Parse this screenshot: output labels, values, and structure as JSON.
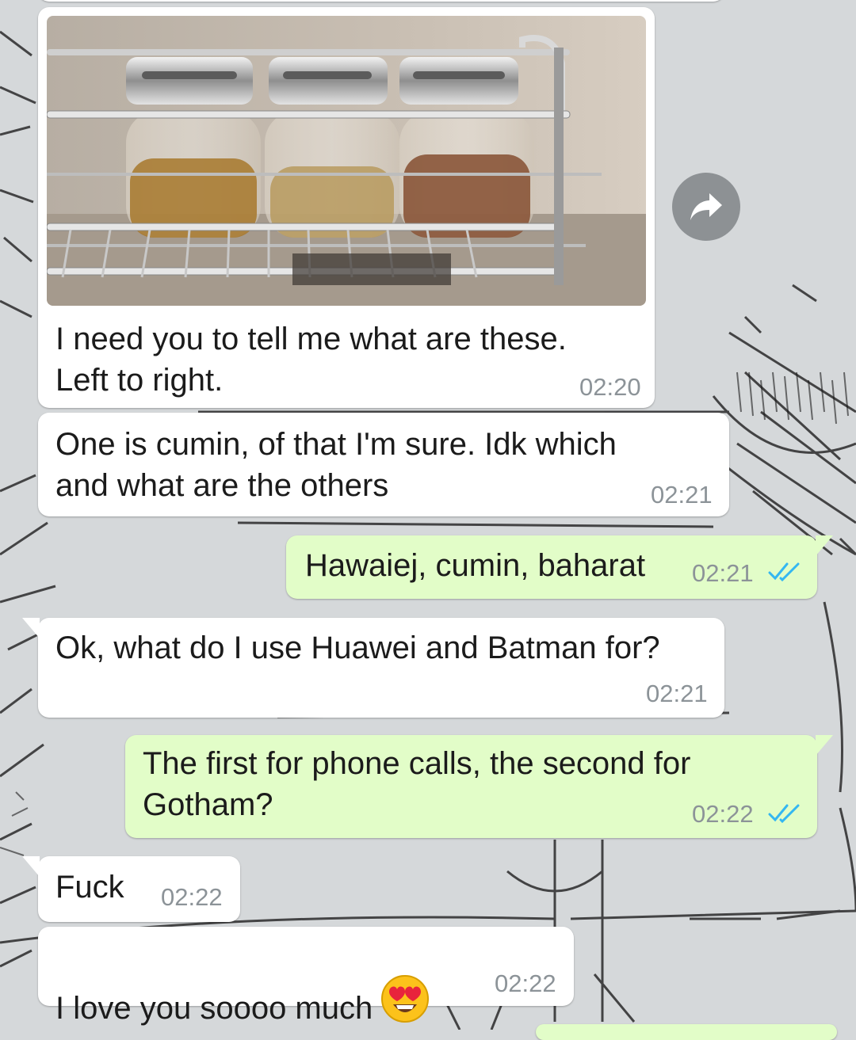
{
  "colors": {
    "incoming_bubble": "#ffffff",
    "outgoing_bubble": "#e2fdc8",
    "timestamp": "#8c9398",
    "read_ticks": "#34b7f1",
    "wallpaper": "#d5d8da"
  },
  "messages": [
    {
      "id": "m1",
      "direction": "incoming",
      "has_image": true,
      "text": "I need you to tell me what are these.\nLeft to right.",
      "time": "02:20"
    },
    {
      "id": "m2",
      "direction": "incoming",
      "text": "One is cumin, of that I'm sure. Idk which\nand what are the others",
      "time": "02:21"
    },
    {
      "id": "m3",
      "direction": "outgoing",
      "text": "Hawaiej, cumin, baharat",
      "time": "02:21",
      "status": "read"
    },
    {
      "id": "m4",
      "direction": "incoming",
      "text": "Ok, what do I use Huawei and Batman for?",
      "time": "02:21"
    },
    {
      "id": "m5",
      "direction": "outgoing",
      "text": "The first for phone calls, the second for\nGotham?",
      "time": "02:22",
      "status": "read"
    },
    {
      "id": "m6",
      "direction": "incoming",
      "text": "Fuck",
      "time": "02:22"
    },
    {
      "id": "m7",
      "direction": "incoming",
      "text": "I love you soooo much",
      "emoji": "heart-eyes",
      "time": "02:22"
    }
  ],
  "icons": {
    "forward": "forward-arrow-icon",
    "read_receipt": "double-check-icon"
  }
}
